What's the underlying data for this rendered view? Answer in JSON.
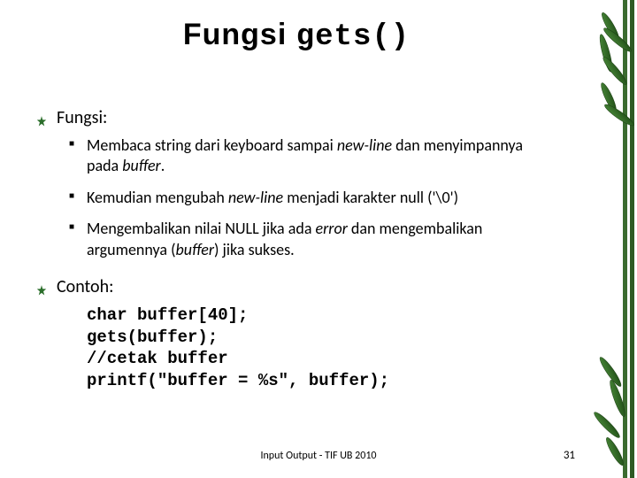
{
  "title": {
    "prefix": "Fungsi ",
    "code": "gets()"
  },
  "sections": [
    {
      "heading": "Fungsi:",
      "bullets": [
        "Membaca string dari keyboard sampai <em>new-line</em> dan menyimpannya pada <em>buffer</em>.",
        "Kemudian mengubah <em>new-line</em> menjadi karakter null ('\\0')",
        "Mengembalikan nilai NULL jika ada <em>error</em> dan mengembalikan argumennya (<em>buffer</em>) jika sukses."
      ]
    },
    {
      "heading": "Contoh:",
      "code": "char buffer[40];\ngets(buffer);\n//cetak buffer\nprintf(\"buffer = %s\", buffer);"
    }
  ],
  "footer": "Input Output - TIF UB 2010",
  "page_number": "31"
}
